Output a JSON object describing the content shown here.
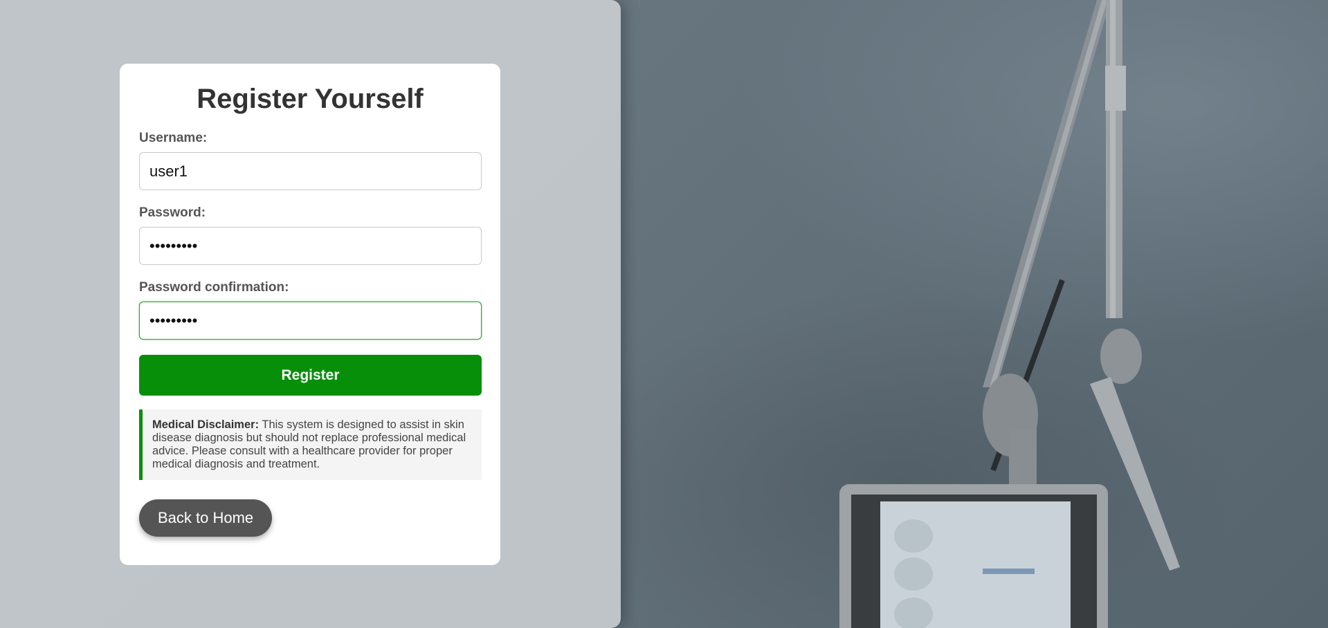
{
  "form": {
    "title": "Register Yourself",
    "username": {
      "label": "Username:",
      "value": "user1"
    },
    "password": {
      "label": "Password:",
      "value": "•••••••••"
    },
    "password_confirmation": {
      "label": "Password confirmation:",
      "value": "•••••••••"
    },
    "register_label": "Register"
  },
  "disclaimer": {
    "heading": "Medical Disclaimer:",
    "text": " This system is designed to assist in skin disease diagnosis but should not replace professional medical advice. Please consult with a healthcare provider for proper medical diagnosis and treatment."
  },
  "back_home_label": "Back to Home",
  "colors": {
    "accent": "#088f0a",
    "back_button": "#555555",
    "panel": "#c3c8cb"
  },
  "background": {
    "image": "laser-medical-device-photo"
  }
}
